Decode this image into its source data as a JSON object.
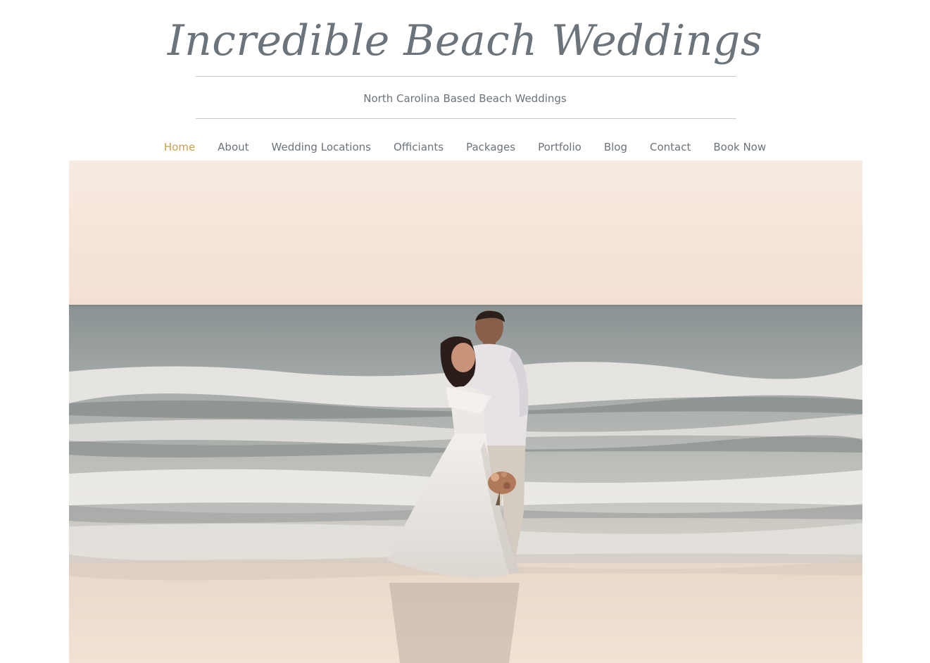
{
  "header": {
    "site_title": "Incredible Beach Weddings",
    "tagline": "North Carolina Based Beach Weddings"
  },
  "nav": {
    "items": [
      {
        "label": "Home",
        "active": true
      },
      {
        "label": "About"
      },
      {
        "label": "Wedding Locations"
      },
      {
        "label": "Officiants"
      },
      {
        "label": "Packages"
      },
      {
        "label": "Portfolio"
      },
      {
        "label": "Blog"
      },
      {
        "label": "Contact"
      },
      {
        "label": "Book Now"
      }
    ]
  },
  "colors": {
    "text": "#6b737b",
    "accent_active": "#c9a04a",
    "rule": "#c9cccf",
    "sky": "#f5e4d6",
    "sand": "#efdfd0"
  }
}
